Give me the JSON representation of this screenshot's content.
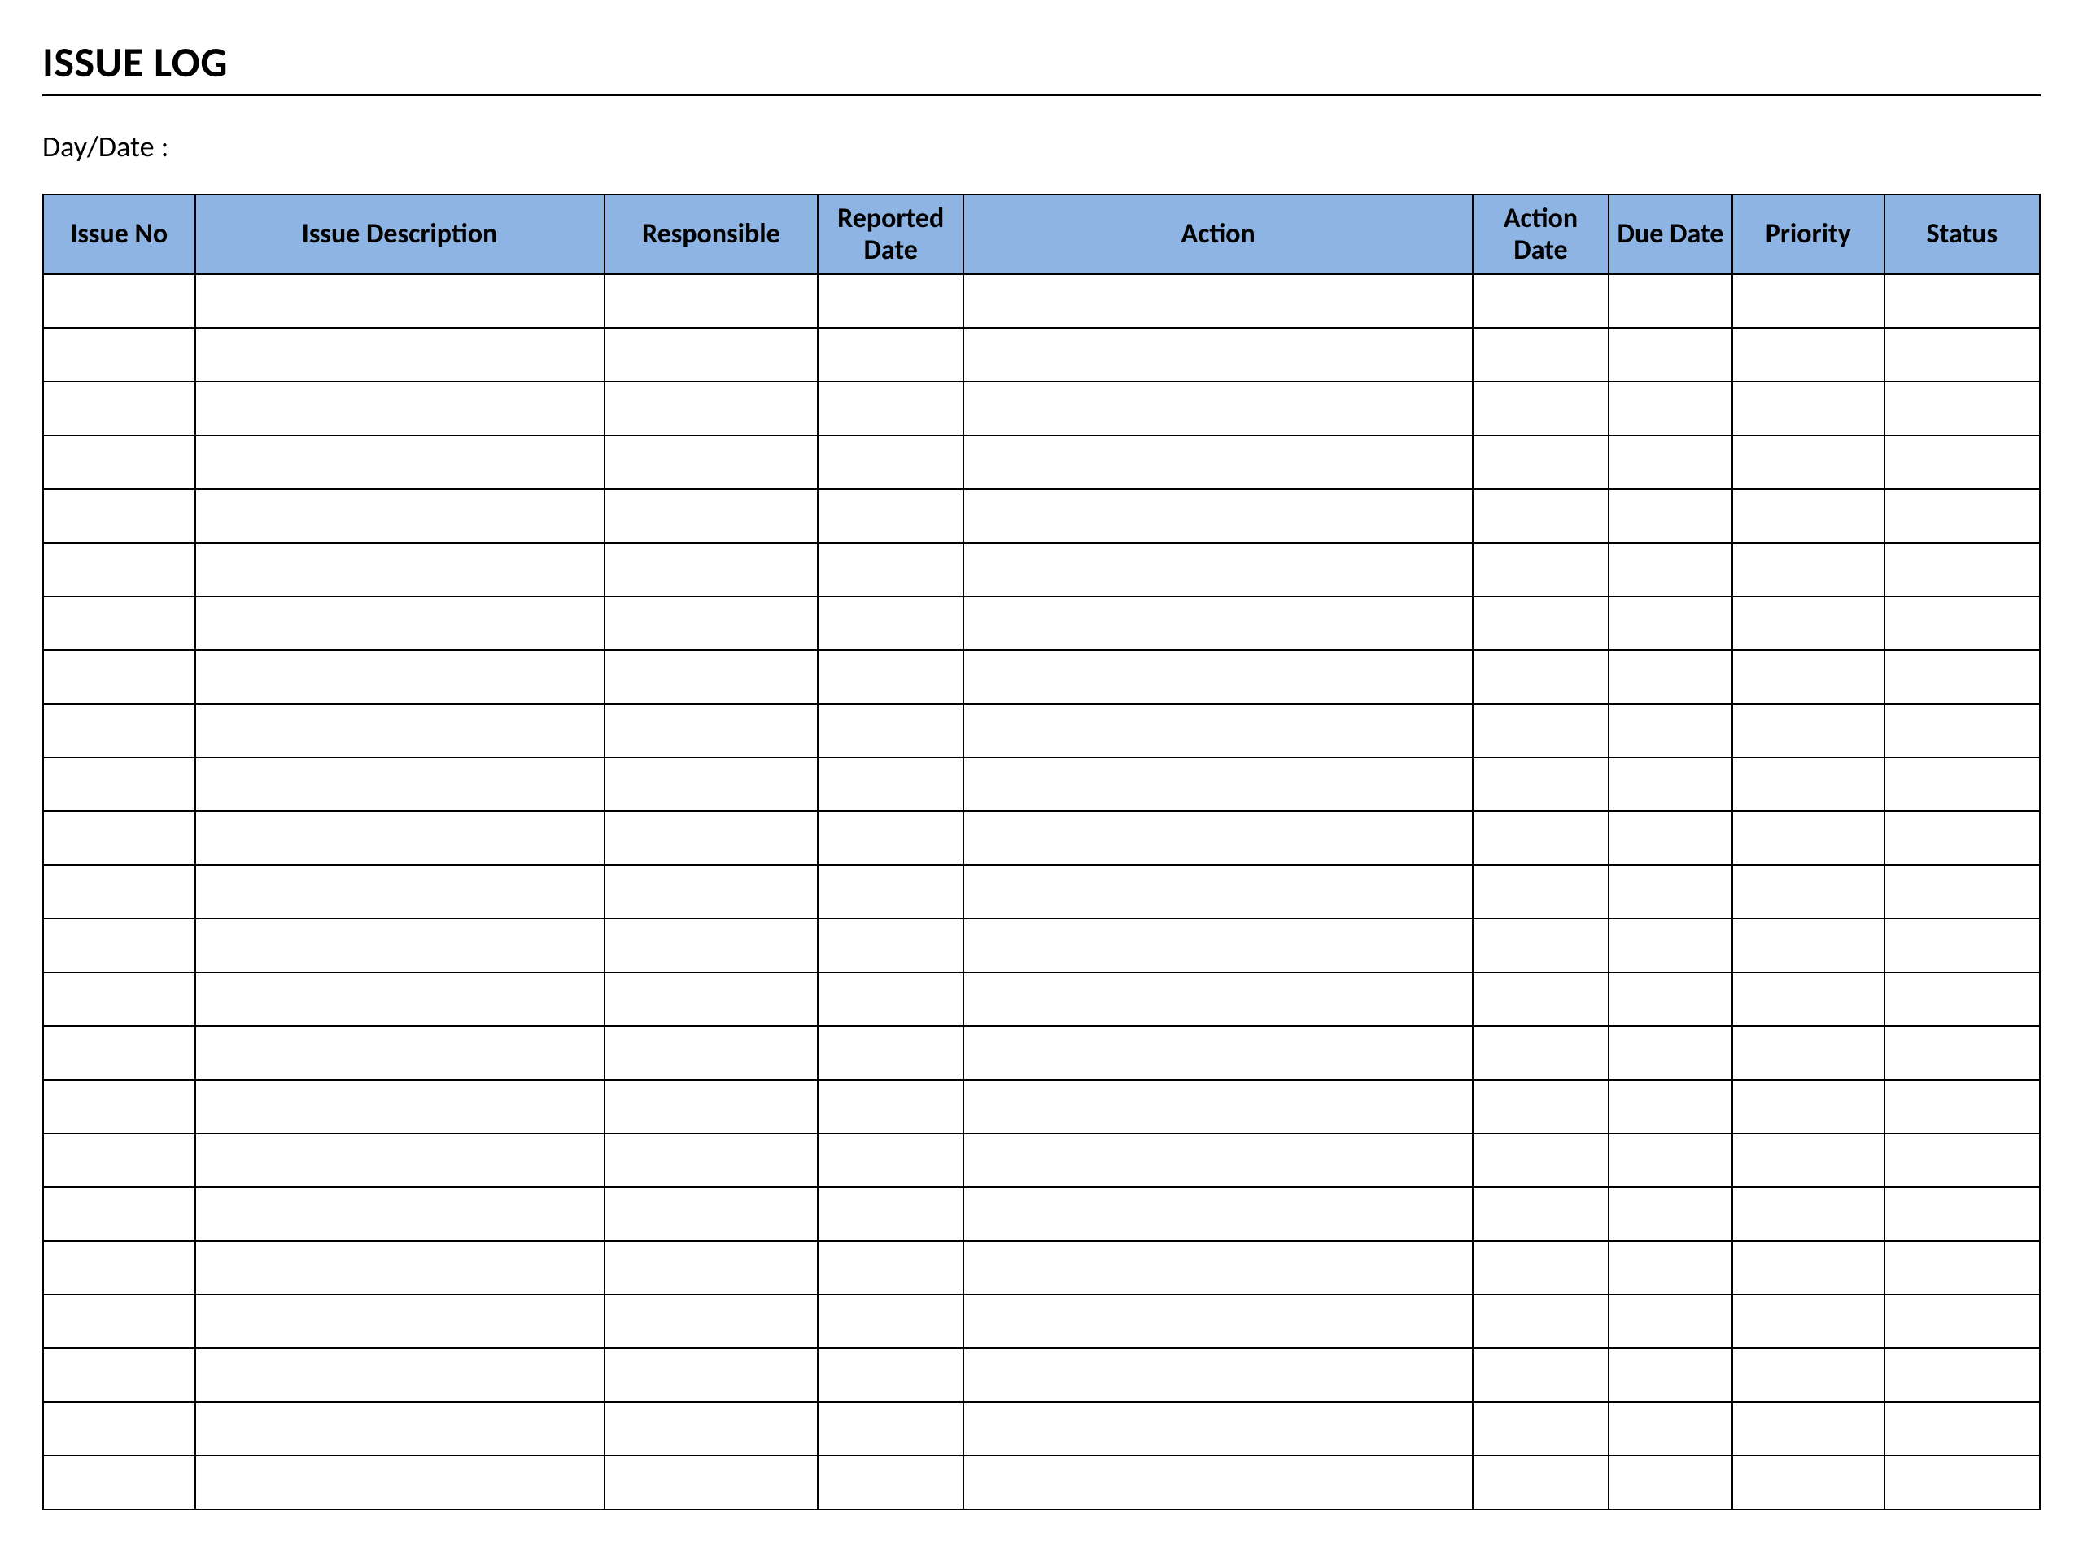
{
  "title": "ISSUE LOG",
  "day_date_label": "Day/Date :",
  "columns": [
    "Issue No",
    "Issue Description",
    "Responsible",
    "Reported Date",
    "Action",
    "Action Date",
    "Due Date",
    "Priority",
    "Status"
  ],
  "rows": [
    [
      "",
      "",
      "",
      "",
      "",
      "",
      "",
      "",
      ""
    ],
    [
      "",
      "",
      "",
      "",
      "",
      "",
      "",
      "",
      ""
    ],
    [
      "",
      "",
      "",
      "",
      "",
      "",
      "",
      "",
      ""
    ],
    [
      "",
      "",
      "",
      "",
      "",
      "",
      "",
      "",
      ""
    ],
    [
      "",
      "",
      "",
      "",
      "",
      "",
      "",
      "",
      ""
    ],
    [
      "",
      "",
      "",
      "",
      "",
      "",
      "",
      "",
      ""
    ],
    [
      "",
      "",
      "",
      "",
      "",
      "",
      "",
      "",
      ""
    ],
    [
      "",
      "",
      "",
      "",
      "",
      "",
      "",
      "",
      ""
    ],
    [
      "",
      "",
      "",
      "",
      "",
      "",
      "",
      "",
      ""
    ],
    [
      "",
      "",
      "",
      "",
      "",
      "",
      "",
      "",
      ""
    ],
    [
      "",
      "",
      "",
      "",
      "",
      "",
      "",
      "",
      ""
    ],
    [
      "",
      "",
      "",
      "",
      "",
      "",
      "",
      "",
      ""
    ],
    [
      "",
      "",
      "",
      "",
      "",
      "",
      "",
      "",
      ""
    ],
    [
      "",
      "",
      "",
      "",
      "",
      "",
      "",
      "",
      ""
    ],
    [
      "",
      "",
      "",
      "",
      "",
      "",
      "",
      "",
      ""
    ],
    [
      "",
      "",
      "",
      "",
      "",
      "",
      "",
      "",
      ""
    ],
    [
      "",
      "",
      "",
      "",
      "",
      "",
      "",
      "",
      ""
    ],
    [
      "",
      "",
      "",
      "",
      "",
      "",
      "",
      "",
      ""
    ],
    [
      "",
      "",
      "",
      "",
      "",
      "",
      "",
      "",
      ""
    ],
    [
      "",
      "",
      "",
      "",
      "",
      "",
      "",
      "",
      ""
    ],
    [
      "",
      "",
      "",
      "",
      "",
      "",
      "",
      "",
      ""
    ],
    [
      "",
      "",
      "",
      "",
      "",
      "",
      "",
      "",
      ""
    ],
    [
      "",
      "",
      "",
      "",
      "",
      "",
      "",
      "",
      ""
    ]
  ],
  "colors": {
    "header_bg": "#8DB4E2",
    "border": "#000000"
  }
}
